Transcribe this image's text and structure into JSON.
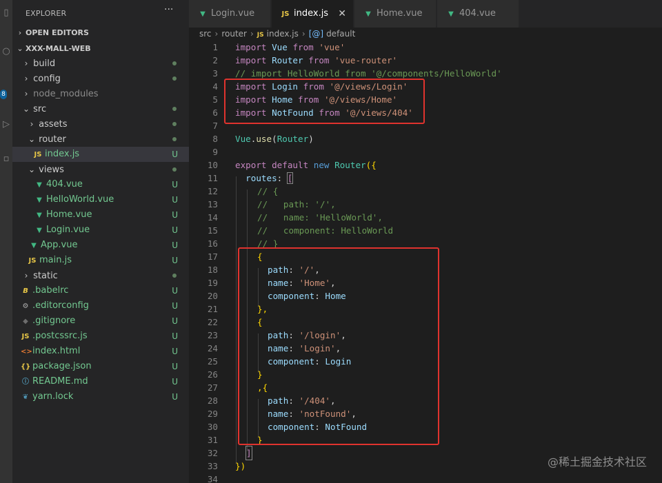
{
  "sidebar": {
    "title": "EXPLORER",
    "more_label": "···",
    "open_editors": "OPEN EDITORS",
    "project": "XXX-MALL-WEB",
    "badge": "8",
    "tree": [
      {
        "name": "build",
        "status": "dot"
      },
      {
        "name": "config",
        "status": "dot"
      },
      {
        "name": "node_modules",
        "status": ""
      },
      {
        "name": "src",
        "status": "dot"
      },
      {
        "name": "assets",
        "status": "dot"
      },
      {
        "name": "router",
        "status": "dot"
      },
      {
        "name": "index.js",
        "status": "U",
        "icon": "JS"
      },
      {
        "name": "views",
        "status": "dot"
      },
      {
        "name": "404.vue",
        "status": "U"
      },
      {
        "name": "HelloWorld.vue",
        "status": "U"
      },
      {
        "name": "Home.vue",
        "status": "U"
      },
      {
        "name": "Login.vue",
        "status": "U"
      },
      {
        "name": "App.vue",
        "status": "U"
      },
      {
        "name": "main.js",
        "status": "U",
        "icon": "JS"
      },
      {
        "name": "static",
        "status": "dot"
      },
      {
        "name": ".babelrc",
        "status": "U"
      },
      {
        "name": ".editorconfig",
        "status": "U"
      },
      {
        "name": ".gitignore",
        "status": "U"
      },
      {
        "name": ".postcssrc.js",
        "status": "U",
        "icon": "JS"
      },
      {
        "name": "index.html",
        "status": "U"
      },
      {
        "name": "package.json",
        "status": "U"
      },
      {
        "name": "README.md",
        "status": "U"
      },
      {
        "name": "yarn.lock",
        "status": "U"
      }
    ]
  },
  "tabs": [
    {
      "label": "Login.vue"
    },
    {
      "label": "index.js",
      "icon": "JS"
    },
    {
      "label": "Home.vue"
    },
    {
      "label": "404.vue"
    }
  ],
  "tab_close": "✕",
  "breadcrumb": {
    "p1": "src",
    "p2": "router",
    "js": "JS",
    "p3": "index.js",
    "p4": "default",
    "sym": "[@]"
  },
  "code": {
    "line_numbers": [
      "1",
      "2",
      "3",
      "4",
      "5",
      "6",
      "7",
      "8",
      "9",
      "10",
      "11",
      "12",
      "13",
      "14",
      "15",
      "16",
      "17",
      "18",
      "19",
      "20",
      "21",
      "22",
      "23",
      "24",
      "25",
      "26",
      "27",
      "28",
      "29",
      "30",
      "31",
      "32",
      "33",
      "34"
    ],
    "l1": [
      "import",
      "Vue",
      "from",
      "'vue'"
    ],
    "l2": [
      "import",
      "Router",
      "from",
      "'vue-router'"
    ],
    "l3": "// import HelloWorld from '@/components/HelloWorld'",
    "l4": [
      "import",
      "Login",
      "from",
      "'@/views/Login'"
    ],
    "l5": [
      "import",
      "Home",
      "from",
      "'@/views/Home'"
    ],
    "l6": [
      "import",
      "NotFound",
      "from",
      "'@/views/404'"
    ],
    "l8": [
      "Vue",
      ".",
      "use",
      "(",
      "Router",
      ")"
    ],
    "l10": [
      "export",
      "default",
      "new",
      "Router",
      "({"
    ],
    "l11": [
      "routes",
      ": ",
      "["
    ],
    "l12": "// {",
    "l13": "//   path: '/',",
    "l14": "//   name: 'HelloWorld',",
    "l15": "//   component: HelloWorld",
    "l16": "// }",
    "l17": "{",
    "l18": [
      "path",
      ": ",
      "'/'",
      ","
    ],
    "l19": [
      "name",
      ": ",
      "'Home'",
      ","
    ],
    "l20": [
      "component",
      ": ",
      "Home"
    ],
    "l21": "},",
    "l22": "{",
    "l23": [
      "path",
      ": ",
      "'/login'",
      ","
    ],
    "l24": [
      "name",
      ": ",
      "'Login'",
      ","
    ],
    "l25": [
      "component",
      ": ",
      "Login"
    ],
    "l26": "}",
    "l27": ",{",
    "l28": [
      "path",
      ": ",
      "'/404'",
      ","
    ],
    "l29": [
      "name",
      ": ",
      "'notFound'",
      ","
    ],
    "l30": [
      "component",
      ": ",
      "NotFound"
    ],
    "l31": "}",
    "l32": "]",
    "l33": "})"
  },
  "watermark": "@稀土掘金技术社区",
  "colors": {
    "highlight_box": "#e0332e",
    "untracked": "#73c991"
  }
}
